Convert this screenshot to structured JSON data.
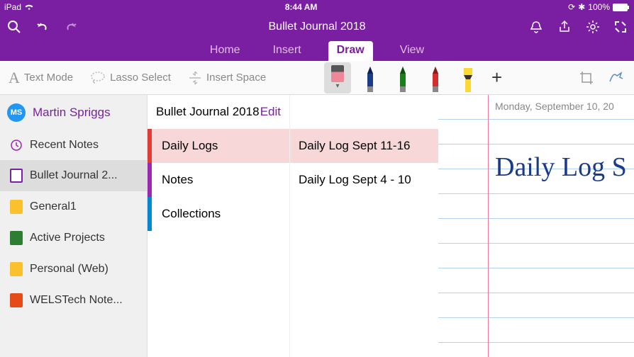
{
  "status": {
    "device": "iPad",
    "time": "8:44 AM",
    "battery": "100%"
  },
  "titleBar": {
    "title": "Bullet Journal 2018"
  },
  "tabs": [
    "Home",
    "Insert",
    "Draw",
    "View"
  ],
  "activeTab": "Draw",
  "toolbar": {
    "textMode": "Text Mode",
    "lasso": "Lasso Select",
    "insertSpace": "Insert Space",
    "pens": [
      {
        "color": "#1a3a8a"
      },
      {
        "color": "#1b7d1b"
      },
      {
        "color": "#d32f2f"
      },
      {
        "color": "#fdd835",
        "highlighter": true
      }
    ]
  },
  "user": {
    "initials": "MS",
    "name": "Martin Spriggs"
  },
  "sidebar": {
    "recent": "Recent Notes",
    "notebooks": [
      {
        "label": "Bullet Journal 2...",
        "color": "#7b1fa2",
        "selected": true
      },
      {
        "label": "General1",
        "color": "#fbc02d"
      },
      {
        "label": "Active Projects",
        "color": "#2e7d32"
      },
      {
        "label": "Personal (Web)",
        "color": "#fbc02d"
      },
      {
        "label": "WELSTech Note...",
        "color": "#e64a19"
      }
    ]
  },
  "sectionHeader": {
    "title": "Bullet Journal 2018",
    "edit": "Edit"
  },
  "sections": [
    {
      "label": "Daily Logs",
      "color": "#e53935",
      "selected": true
    },
    {
      "label": "Notes",
      "color": "#9c27b0"
    },
    {
      "label": "Collections",
      "color": "#0288d1"
    }
  ],
  "pages": [
    {
      "label": "Daily Log Sept 11-16",
      "selected": true
    },
    {
      "label": "Daily Log Sept 4 - 10"
    }
  ],
  "canvas": {
    "date": "Monday, September 10, 20",
    "handwriting": "Daily Log S"
  }
}
